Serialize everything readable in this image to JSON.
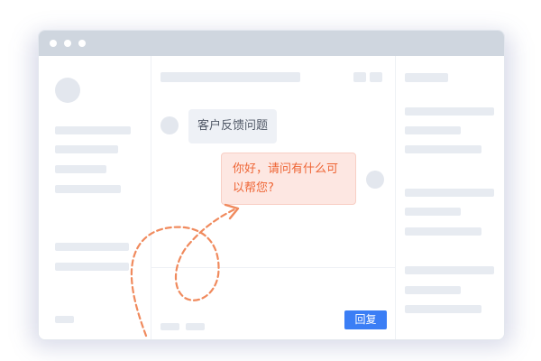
{
  "chat": {
    "incoming_message": "客户反馈问题",
    "outgoing_message": "你好，请问有什么可以帮您?"
  },
  "composer": {
    "reply_label": "回复"
  },
  "colors": {
    "accent": "#3b7ef5",
    "outgoing_text": "#ee6535",
    "outgoing_bubble": "#fde7e2",
    "arrow": "#f08a5d"
  },
  "icons": {
    "arrow": "dashed-arrow-icon"
  }
}
